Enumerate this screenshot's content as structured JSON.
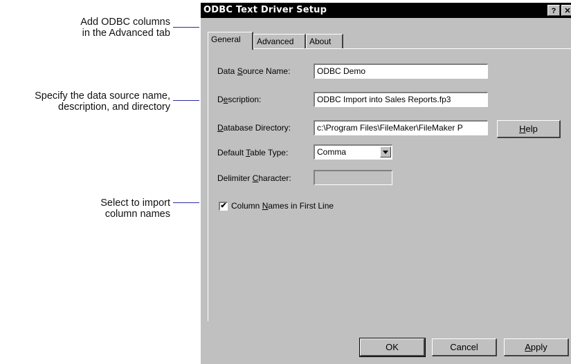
{
  "callouts": {
    "advanced": {
      "line1": "Add ODBC columns",
      "line2": "in the Advanced tab"
    },
    "datasource": {
      "line1": "Specify the data source name,",
      "line2": "description, and directory"
    },
    "import": {
      "line1": "Select to import",
      "line2": "column names"
    }
  },
  "dialog": {
    "title": "ODBC Text Driver Setup",
    "help_glyph": "?",
    "close_glyph": "✕"
  },
  "tabs": [
    {
      "label": "General"
    },
    {
      "label": "Advanced"
    },
    {
      "label": "About"
    }
  ],
  "form": {
    "data_source_name": {
      "label_pre": "Data ",
      "label_key": "S",
      "label_post": "ource Name:",
      "value": "ODBC Demo"
    },
    "description": {
      "label_pre": "D",
      "label_key": "e",
      "label_post": "scription:",
      "value": "ODBC Import into Sales Reports.fp3"
    },
    "database_directory": {
      "label_pre": "",
      "label_key": "D",
      "label_post": "atabase Directory:",
      "value": "c:\\Program Files\\FileMaker\\FileMaker P"
    },
    "default_table_type": {
      "label_pre": "Default ",
      "label_key": "T",
      "label_post": "able Type:",
      "value": "Comma"
    },
    "delimiter_character": {
      "label_pre": "Delimiter ",
      "label_key": "C",
      "label_post": "haracter:",
      "value": ""
    },
    "column_names": {
      "label_pre": "Column ",
      "label_key": "N",
      "label_post": "ames in First Line",
      "checked": true,
      "check_glyph": "✔"
    }
  },
  "buttons": {
    "help": {
      "pre": "",
      "key": "H",
      "post": "elp"
    },
    "ok": "OK",
    "cancel": "Cancel",
    "apply": {
      "pre": "",
      "key": "A",
      "post": "pply"
    }
  }
}
